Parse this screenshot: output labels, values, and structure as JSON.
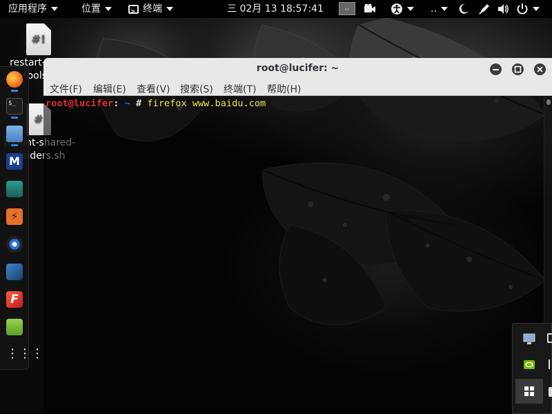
{
  "topbar": {
    "applications": "应用程序",
    "places": "位置",
    "terminal_app": "终端",
    "datetime": "三 02月 13  18:57:41",
    "workspace_label": "..",
    "keyboard_indicator": "..",
    "icons": [
      "camera-icon",
      "accessibility-icon",
      "night-mode-icon",
      "pen-icon",
      "volume-icon",
      "power-icon"
    ]
  },
  "desktop": {
    "icons": [
      {
        "label_line1": "restart-",
        "label_line2": "tools",
        "glyph": "#!"
      },
      {
        "label_line1": "mount-shared-",
        "label_line2": "folders.sh",
        "glyph": "#"
      }
    ]
  },
  "dock": {
    "apps": [
      "firefox-icon",
      "terminal-icon",
      "files-icon",
      "metasploit-icon",
      "armitage-icon",
      "burpsuite-icon",
      "maltego-icon",
      "beef-icon",
      "faraday-icon",
      "leafpad-icon",
      "show-apps-icon"
    ]
  },
  "terminal": {
    "title": "root@lucifer: ~",
    "menu": [
      "文件(F)",
      "编辑(E)",
      "查看(V)",
      "搜索(S)",
      "终端(T)",
      "帮助(H)"
    ],
    "prompt_user": "root@lucifer",
    "prompt_colon": ":",
    "prompt_path": " ~",
    "prompt_symbol": "#",
    "command": " firefox www.baidu.com"
  },
  "colors": {
    "prompt_user": "#e22d2d",
    "prompt_path": "#3466c2",
    "command": "#f2e24a",
    "header_bg": "#e8e8e7"
  }
}
